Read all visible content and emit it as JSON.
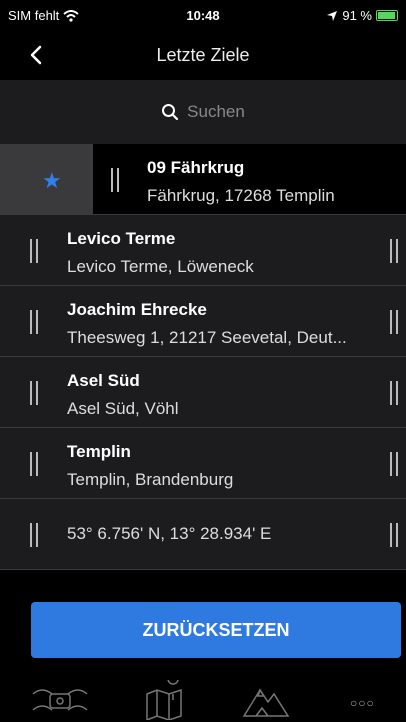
{
  "status": {
    "carrier": "SIM fehlt",
    "time": "10:48",
    "battery": "91 %"
  },
  "nav": {
    "title": "Letzte Ziele"
  },
  "search": {
    "placeholder": "Suchen"
  },
  "destinations": [
    {
      "title": "09 Fährkrug",
      "subtitle": "Fährkrug, 17268 Templin",
      "favorite": true
    },
    {
      "title": "Levico Terme",
      "subtitle": "Levico Terme, Löweneck"
    },
    {
      "title": "Joachim Ehrecke",
      "subtitle": "Theesweg 1, 21217 Seevetal, Deut..."
    },
    {
      "title": "Asel Süd",
      "subtitle": "Asel Süd, Vöhl"
    },
    {
      "title": "Templin",
      "subtitle": "Templin, Brandenburg"
    },
    {
      "title": "",
      "subtitle": "53° 6.756' N, 13° 28.934' E"
    }
  ],
  "actions": {
    "reset_label": "ZURÜCKSETZEN"
  },
  "tabs": [
    {
      "icon": "motorcycle-icon"
    },
    {
      "icon": "map-icon"
    },
    {
      "icon": "mountain-icon"
    },
    {
      "icon": "more-icon",
      "label": "○○○"
    }
  ],
  "colors": {
    "accent": "#2f7ae0",
    "star": "#2f80ed",
    "battery": "#5ad45a"
  }
}
